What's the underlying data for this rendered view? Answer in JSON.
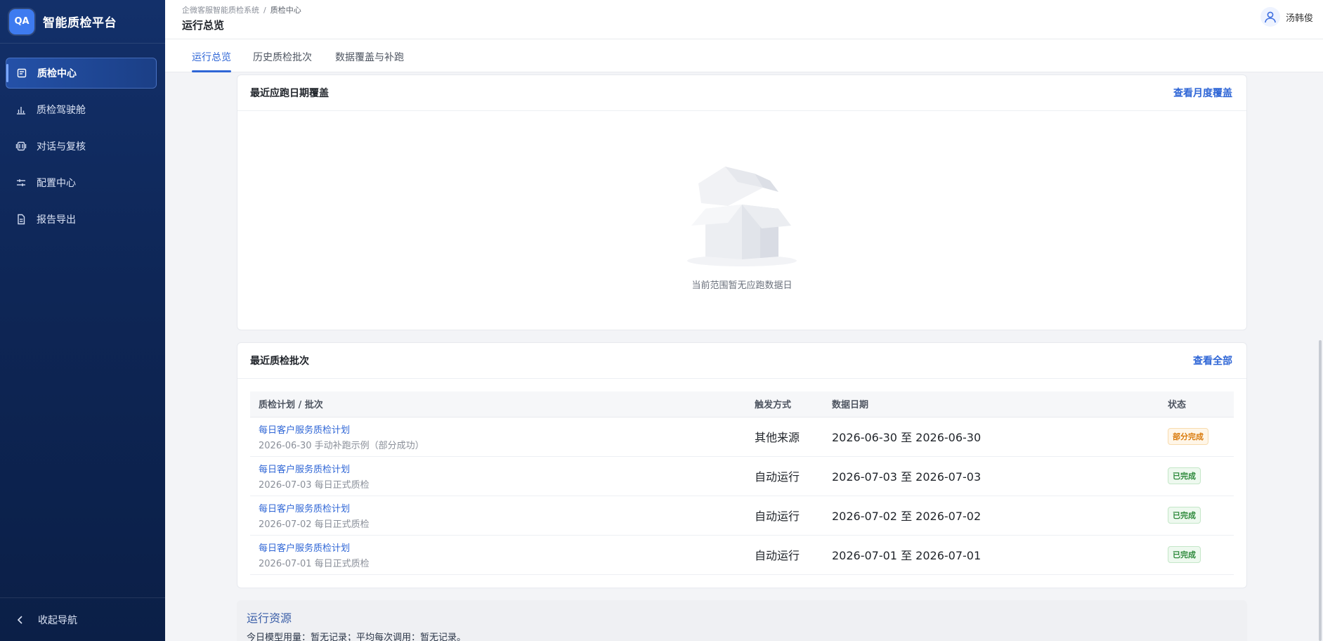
{
  "brand": {
    "logo": "QA",
    "title": "智能质检平台"
  },
  "sidebar": {
    "items": [
      {
        "label": "质检中心",
        "icon": "document-icon",
        "active": true
      },
      {
        "label": "质检驾驶舱",
        "icon": "bar-chart-icon",
        "active": false
      },
      {
        "label": "对话与复核",
        "icon": "conversation-icon",
        "active": false
      },
      {
        "label": "配置中心",
        "icon": "sliders-icon",
        "active": false
      },
      {
        "label": "报告导出",
        "icon": "file-icon",
        "active": false
      }
    ],
    "collapse_label": "收起导航"
  },
  "header": {
    "breadcrumb": [
      "企微客服智能质检系统",
      "质检中心"
    ],
    "breadcrumb_sep": "/",
    "title": "运行总览",
    "user_name": "汤韩俊"
  },
  "tabs": [
    {
      "label": "运行总览",
      "active": true
    },
    {
      "label": "历史质检批次",
      "active": false
    },
    {
      "label": "数据覆盖与补跑",
      "active": false
    }
  ],
  "coverage_card": {
    "title": "最近应跑日期覆盖",
    "link": "查看月度覆盖",
    "empty_text": "当前范围暂无应跑数据日"
  },
  "batches_card": {
    "title": "最近质检批次",
    "link": "查看全部",
    "columns": [
      "质检计划 / 批次",
      "触发方式",
      "数据日期",
      "状态"
    ],
    "rows": [
      {
        "name": "每日客户服务质检计划",
        "sub": "2026-06-30 手动补跑示例（部分成功）",
        "trigger": "其他来源",
        "date": "2026-06-30 至 2026-06-30",
        "status": "部分完成",
        "status_type": "partial"
      },
      {
        "name": "每日客户服务质检计划",
        "sub": "2026-07-03 每日正式质检",
        "trigger": "自动运行",
        "date": "2026-07-03 至 2026-07-03",
        "status": "已完成",
        "status_type": "done"
      },
      {
        "name": "每日客户服务质检计划",
        "sub": "2026-07-02 每日正式质检",
        "trigger": "自动运行",
        "date": "2026-07-02 至 2026-07-02",
        "status": "已完成",
        "status_type": "done"
      },
      {
        "name": "每日客户服务质检计划",
        "sub": "2026-07-01 每日正式质检",
        "trigger": "自动运行",
        "date": "2026-07-01 至 2026-07-01",
        "status": "已完成",
        "status_type": "done"
      }
    ]
  },
  "resource": {
    "title": "运行资源",
    "text": "今日模型用量：暂无记录；平均每次调用：暂无记录。"
  },
  "colors": {
    "accent": "#2f66d6",
    "sidebar_bg": "#0e2656",
    "partial": "#d97a0b",
    "done": "#2e8a3c"
  }
}
